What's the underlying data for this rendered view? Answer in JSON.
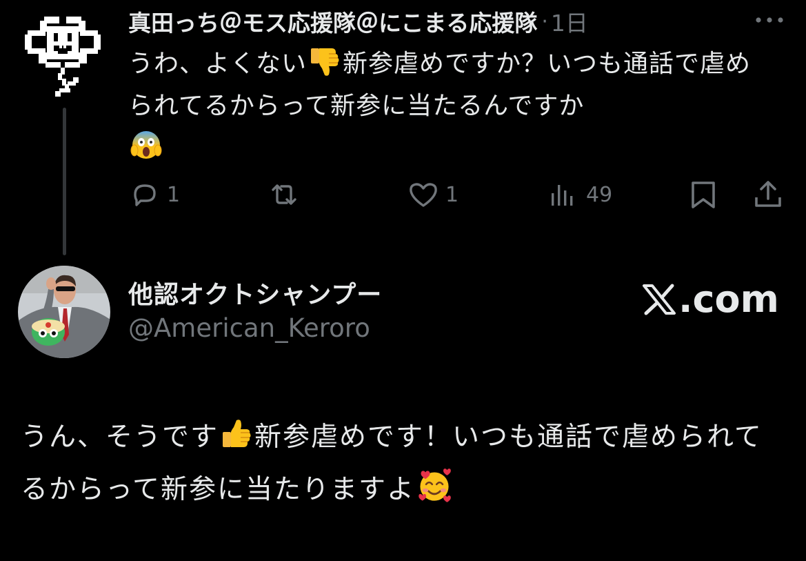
{
  "tweet": {
    "display_name": "真田っち＠モス応援隊＠にこまる応援隊",
    "separator": "·",
    "time": "1日",
    "text_parts": {
      "a": "うわ、よくない",
      "b": "新参虐めですか？いつも通話で虐められてるからって新参に当たるんですか"
    },
    "emojis": [
      "thumbs-down",
      "face-screaming-in-fear"
    ]
  },
  "actions": {
    "reply_count": "1",
    "retweet_count": "",
    "like_count": "1",
    "views_count": "49"
  },
  "quoted": {
    "display_name": "他認オクトシャンプー",
    "handle": "@American_Keroro",
    "site_label": ".com",
    "text_parts": {
      "a": "うん、そうです",
      "b": "新参虐めです！いつも通話で虐められてるからって新参に当たりますよ"
    },
    "emojis": [
      "thumbs-up",
      "smiling-face-with-hearts"
    ]
  },
  "colors": {
    "background": "#000000",
    "text_primary": "#e7e9ea",
    "text_secondary": "#71767b",
    "thread_line": "#333639"
  }
}
